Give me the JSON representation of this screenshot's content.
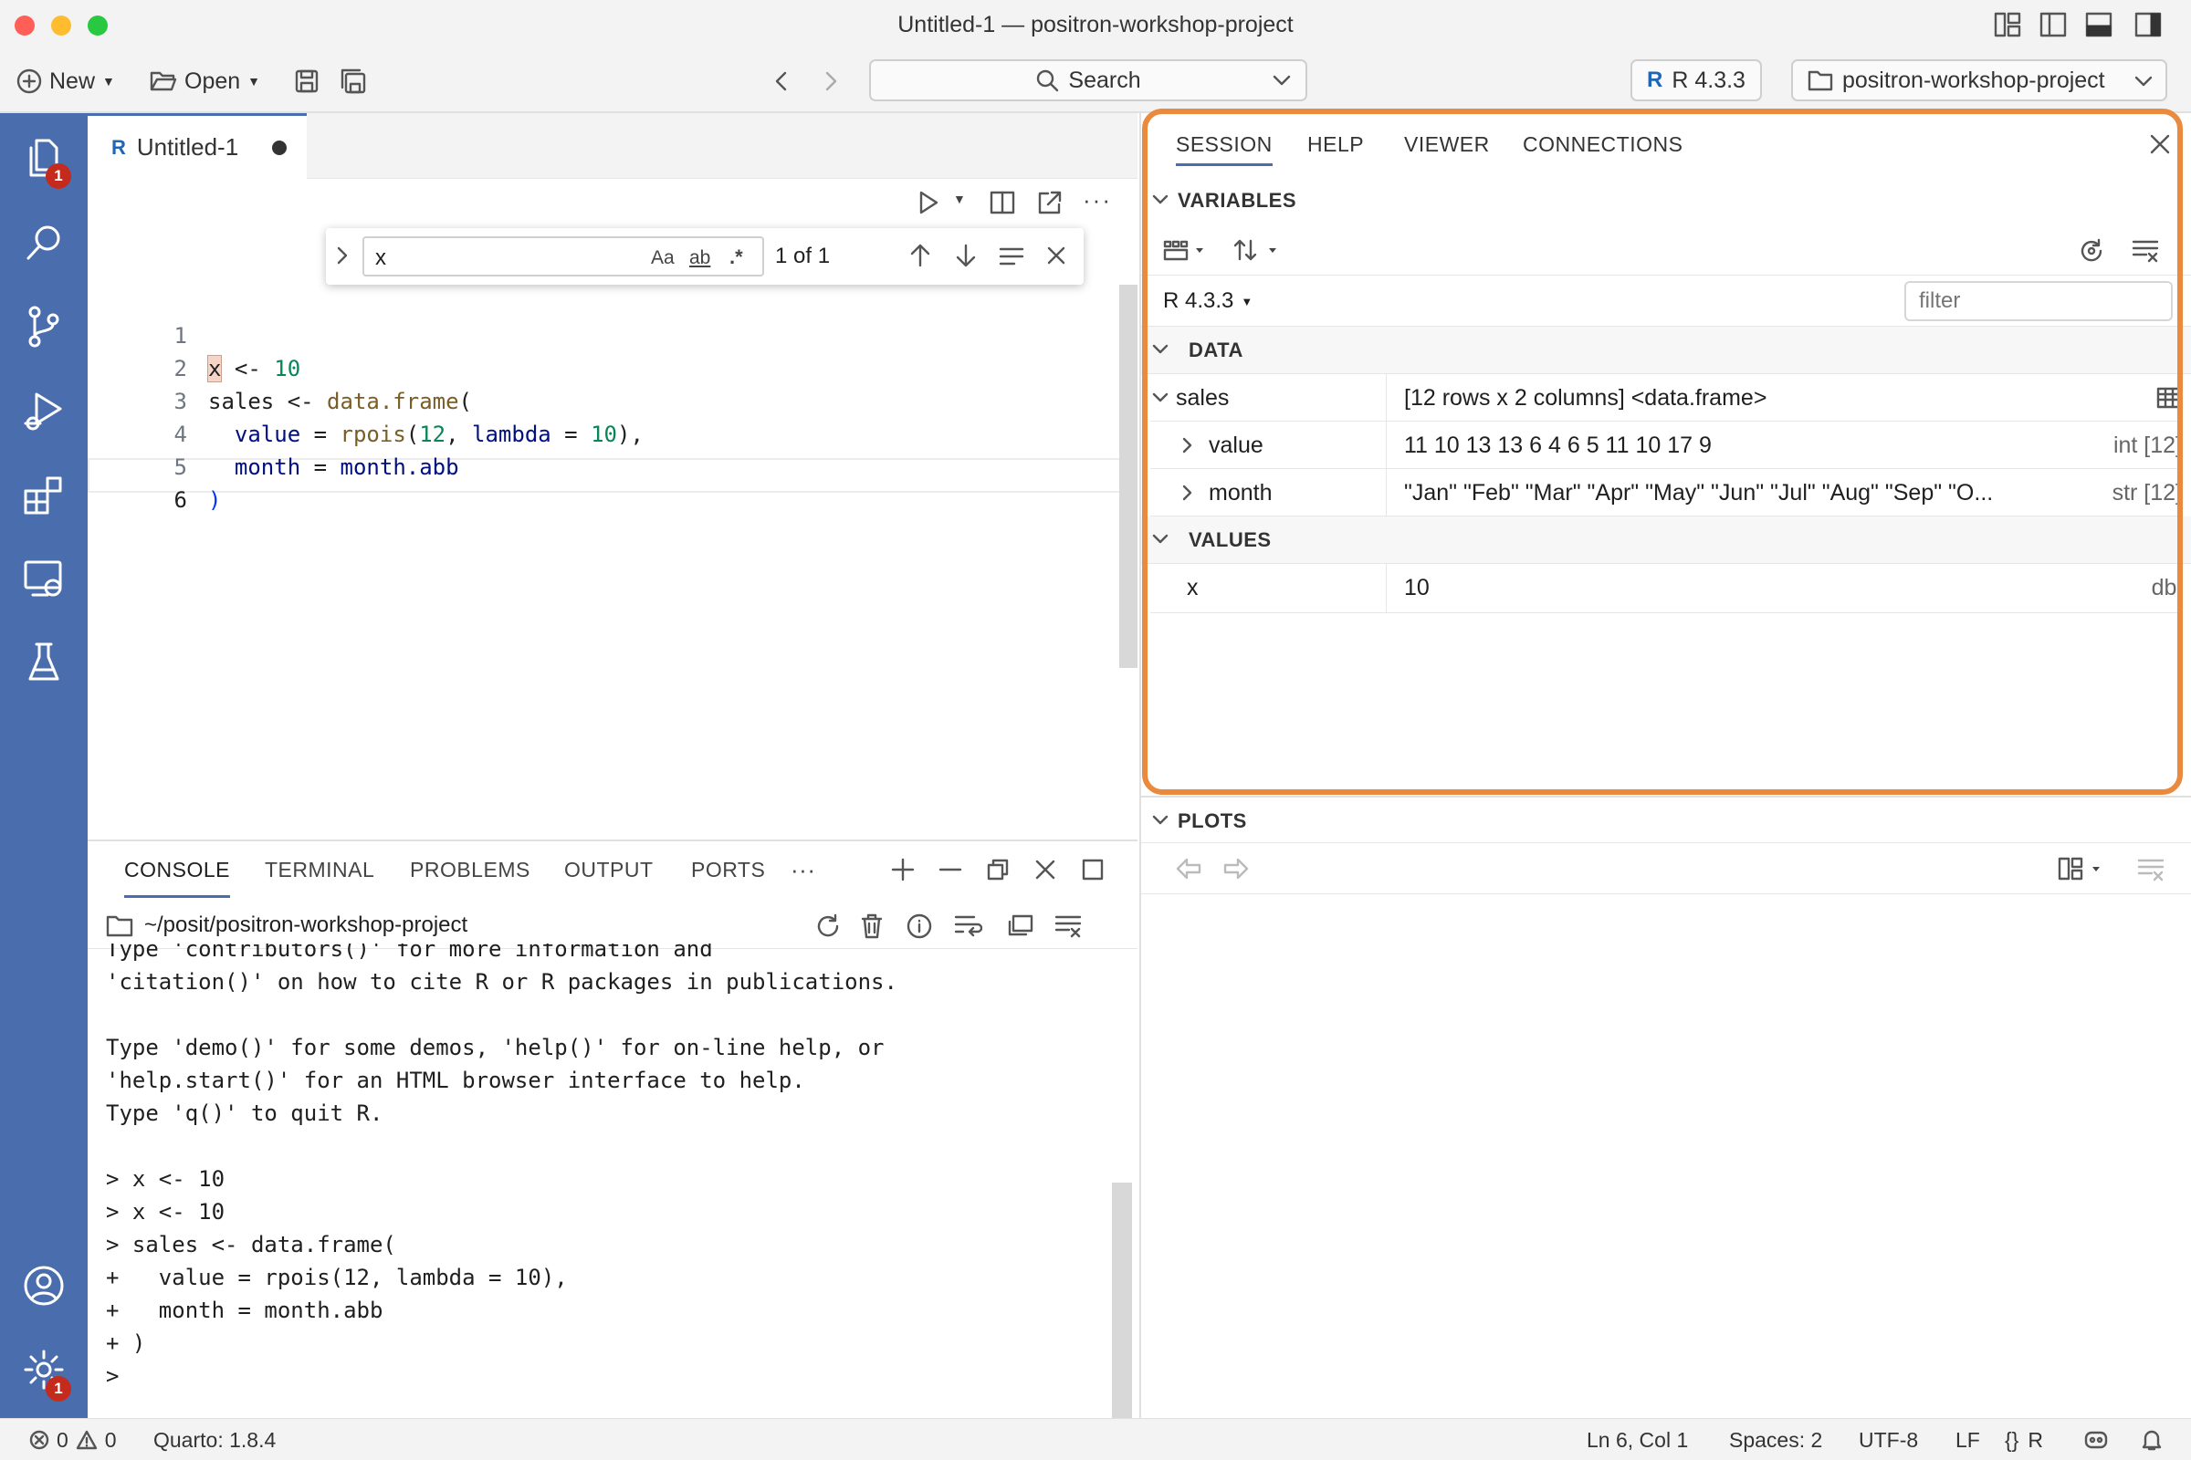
{
  "window": {
    "title": "Untitled-1 — positron-workshop-project"
  },
  "toolbar": {
    "new_label": "New",
    "open_label": "Open",
    "search_label": "Search",
    "r_version": "R 4.3.3",
    "project": "positron-workshop-project"
  },
  "activity": {
    "explorer_badge": "1",
    "settings_badge": "1"
  },
  "editor": {
    "tab_label": "Untitled-1",
    "find": {
      "query": "x",
      "aa": "Aa",
      "ab": "ab",
      "regex": ".*",
      "count": "1 of 1"
    },
    "line_numbers": [
      "1",
      "2",
      "3",
      "4",
      "5",
      "6"
    ]
  },
  "panel": {
    "tabs": [
      "CONSOLE",
      "TERMINAL",
      "PROBLEMS",
      "OUTPUT",
      "PORTS",
      "···"
    ],
    "path": "~/posit/positron-workshop-project",
    "console_lines": [
      "Type 'contributors()' for more information and",
      "'citation()' on how to cite R or R packages in publications.",
      "",
      "Type 'demo()' for some demos, 'help()' for on-line help, or",
      "'help.start()' for an HTML browser interface to help.",
      "Type 'q()' to quit R.",
      "",
      "> x <- 10",
      "> x <- 10",
      "> sales <- data.frame(",
      "+   value = rpois(12, lambda = 10),",
      "+   month = month.abb",
      "+ )",
      ">"
    ]
  },
  "session": {
    "tabs": [
      "SESSION",
      "HELP",
      "VIEWER",
      "CONNECTIONS"
    ],
    "variables_title": "VARIABLES",
    "interpreter": "R 4.3.3",
    "filter_placeholder": "filter",
    "data_title": "DATA",
    "values_title": "VALUES",
    "plots_title": "PLOTS",
    "rows": {
      "sales": {
        "name": "sales",
        "value": "[12 rows x 2 columns] <data.frame>"
      },
      "value": {
        "name": "value",
        "value": "11 10 13 13 6 4 6 5 11 10 17 9",
        "type": "int [12]"
      },
      "month": {
        "name": "month",
        "value": "\"Jan\" \"Feb\" \"Mar\" \"Apr\" \"May\" \"Jun\" \"Jul\" \"Aug\" \"Sep\" \"O...",
        "type": "str [12]"
      },
      "x": {
        "name": "x",
        "value": "10",
        "type": "dbl"
      }
    }
  },
  "status": {
    "errors": "0",
    "warnings": "0",
    "quarto": "Quarto: 1.8.4",
    "position": "Ln 6, Col 1",
    "spaces": "Spaces: 2",
    "encoding": "UTF-8",
    "eol": "LF",
    "language": "R"
  },
  "colors": {
    "accent": "#4a6ead",
    "highlight": "#e98a3e",
    "badge": "#c42b1c"
  }
}
